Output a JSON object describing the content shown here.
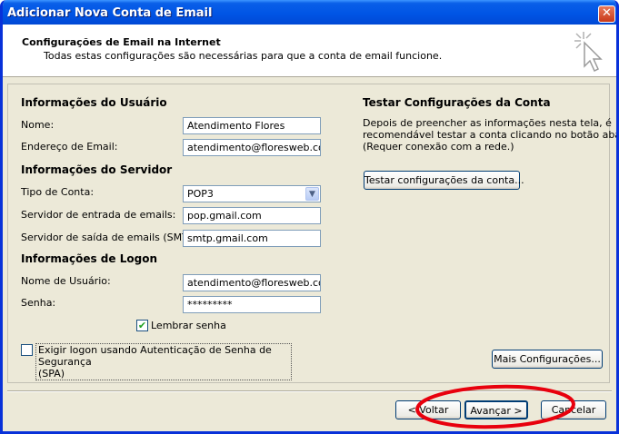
{
  "window": {
    "title": "Adicionar Nova Conta de Email",
    "close_label": "✕"
  },
  "header": {
    "title": "Configurações de Email na Internet",
    "subtitle": "Todas estas configurações são necessárias para que a conta de email funcione."
  },
  "user_info": {
    "section": "Informações do Usuário",
    "name_label": "Nome:",
    "name_value": "Atendimento Flores",
    "email_label": "Endereço de Email:",
    "email_value": "atendimento@floresweb.com."
  },
  "server_info": {
    "section": "Informações do Servidor",
    "account_type_label": "Tipo de Conta:",
    "account_type_value": "POP3",
    "incoming_label": "Servidor de entrada de emails:",
    "incoming_value": "pop.gmail.com",
    "outgoing_label": "Servidor de saída de emails (SMTP):",
    "outgoing_value": "smtp.gmail.com"
  },
  "logon_info": {
    "section": "Informações de Logon",
    "username_label": "Nome de Usuário:",
    "username_value": "atendimento@floresweb.com.",
    "password_label": "Senha:",
    "password_value": "*********",
    "remember_label": "Lembrar senha",
    "remember_checked": true,
    "spa_label_line1": "Exigir logon usando Autenticação de Senha de Segurança",
    "spa_label_line2": "(SPA)",
    "spa_checked": false
  },
  "test_settings": {
    "section": "Testar Configurações da Conta",
    "description_line1": "Depois de preencher as informações nesta tela, é",
    "description_line2": "recomendável testar a conta clicando no botão abaixo.",
    "description_line3": "(Requer conexão com a rede.)",
    "test_button": "Testar configurações da conta..."
  },
  "more_settings_button": "Mais Configurações...",
  "footer": {
    "back_button": "< Voltar",
    "next_button": "Avançar >",
    "cancel_button": "Cancelar"
  },
  "colors": {
    "annotation": "#e8000d",
    "title_bar": "#0055e5"
  }
}
